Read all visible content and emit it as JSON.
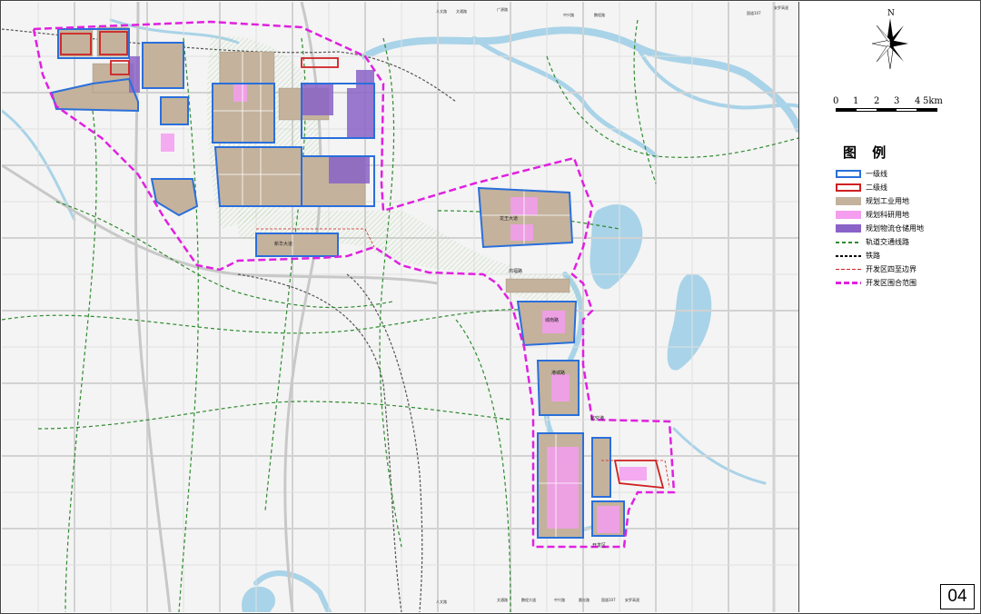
{
  "legend": {
    "title": "图 例",
    "items": [
      {
        "label": "一级线",
        "swatch": "blue-border"
      },
      {
        "label": "二级线",
        "swatch": "red-border"
      },
      {
        "label": "规划工业用地",
        "swatch": "brown-fill"
      },
      {
        "label": "规划科研用地",
        "swatch": "pink-fill"
      },
      {
        "label": "规划物流仓储用地",
        "swatch": "purple-fill"
      },
      {
        "label": "轨道交通线路",
        "swatch": "green-dash"
      },
      {
        "label": "铁路",
        "swatch": "black-dash"
      },
      {
        "label": "开发区四至边界",
        "swatch": "red-dash"
      },
      {
        "label": "开发区围合范围",
        "swatch": "magenta-dash"
      }
    ]
  },
  "compass": {
    "north_label": "N"
  },
  "scale_bar": {
    "ticks": [
      "0",
      "1",
      "2",
      "3",
      "4",
      "5km"
    ]
  },
  "page_number": "04",
  "map_labels": {
    "top_roads": [
      "人文路",
      "文通路",
      "广源路",
      "中兴路",
      "鹏程路",
      "国道107",
      "安罗高速"
    ],
    "bottom_roads": [
      "人文路",
      "文通路",
      "鹏程大道",
      "中兴路",
      "晨光路",
      "国道107",
      "安罗高速"
    ],
    "zones": [
      "龙王大道",
      "新华大道",
      "鸿福路",
      "城南路",
      "港城路",
      "航空港",
      "开发区"
    ]
  },
  "colors": {
    "industrial": "#c4b29c",
    "research": "#f59ef0",
    "logistics": "#8a63c8",
    "boundary": "#e020e0",
    "level1": "#2a6fdb",
    "level2": "#d02020",
    "rail_transit": "#2e8b2e",
    "water": "#a9d3e8",
    "green_belt": "#d7ecc9"
  }
}
